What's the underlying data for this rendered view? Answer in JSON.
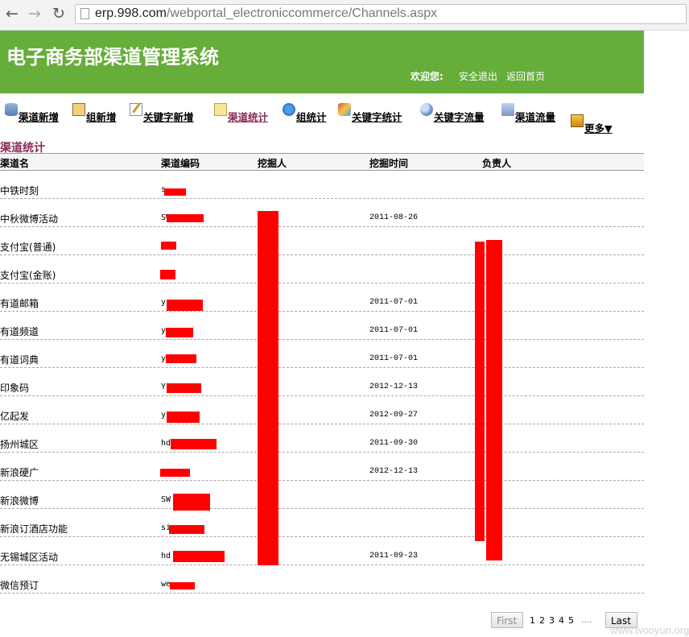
{
  "browser": {
    "url_host": "erp.998.com",
    "url_path": "/webportal_electroniccommerce/Channels.aspx"
  },
  "header": {
    "title": "电子商务部渠道管理系统",
    "welcome": "欢迎您:",
    "logout": "安全退出",
    "home": "返回首页",
    "bg_color": "#66ad3a"
  },
  "toolbar": {
    "items": [
      {
        "label": "渠道新增",
        "icon": "database-icon"
      },
      {
        "label": "组新增",
        "icon": "group-folder-icon"
      },
      {
        "label": "关键字新增",
        "icon": "keyword-edit-icon"
      },
      {
        "label": "渠道统计",
        "icon": "stats-folder-icon",
        "active": true
      },
      {
        "label": "组统计",
        "icon": "globe-stats-icon"
      },
      {
        "label": "关键字统计",
        "icon": "keyword-stats-icon"
      },
      {
        "label": "关键字流量",
        "icon": "magnifier-icon"
      },
      {
        "label": "渠道流量",
        "icon": "channel-flow-icon"
      },
      {
        "label": "更多▼",
        "icon": "package-icon"
      }
    ],
    "active_color": "#8b2a55"
  },
  "section": {
    "title": "渠道统计"
  },
  "table": {
    "columns": [
      "渠道名",
      "渠道编码",
      "挖掘人",
      "挖掘时间",
      "负责人"
    ],
    "rows": [
      {
        "name": "中铁时刻",
        "code": "s  ",
        "digger": "",
        "date": "",
        "owner": ""
      },
      {
        "name": "中秋微博活动",
        "code": "SW        u",
        "digger": "",
        "date": "2011-08-26",
        "owner": ""
      },
      {
        "name": "支付宝(普通)",
        "code": "",
        "digger": "",
        "date": "",
        "owner": ""
      },
      {
        "name": "支付宝(金账)",
        "code": "",
        "digger": "",
        "date": "",
        "owner": ""
      },
      {
        "name": "有道邮箱",
        "code": "y",
        "digger": "",
        "date": "2011-07-01",
        "owner": ""
      },
      {
        "name": "有道频道",
        "code": "y",
        "digger": "",
        "date": "2011-07-01",
        "owner": ""
      },
      {
        "name": "有道词典",
        "code": "y",
        "digger": "",
        "date": "2011-07-01",
        "owner": ""
      },
      {
        "name": "印象码",
        "code": "Y",
        "digger": "",
        "date": "2012-12-13",
        "owner": ""
      },
      {
        "name": "亿起发",
        "code": "y",
        "digger": "",
        "date": "2012-09-27",
        "owner": ""
      },
      {
        "name": "扬州城区",
        "code": "hd",
        "digger": "",
        "date": "2011-09-30",
        "owner": ""
      },
      {
        "name": "新浪硬广",
        "code": "",
        "digger": "",
        "date": "2012-12-13",
        "owner": ""
      },
      {
        "name": "新浪微博",
        "code": "SW",
        "digger": "",
        "date": "",
        "owner": ""
      },
      {
        "name": "新浪订酒店功能",
        "code": "si",
        "digger": "",
        "date": "",
        "owner": ""
      },
      {
        "name": "无锡城区活动",
        "code": "hd",
        "digger": "",
        "date": "2011-09-23",
        "owner": ""
      },
      {
        "name": "微信预订",
        "code": "we",
        "digger": "",
        "date": "",
        "owner": ""
      }
    ]
  },
  "pager": {
    "first": "First",
    "pages": [
      "1",
      "2",
      "3",
      "4",
      "5"
    ],
    "ellipsis": "....",
    "last": "Last"
  },
  "watermark": "www.wooyun.org",
  "redaction_color": "#ff0000"
}
